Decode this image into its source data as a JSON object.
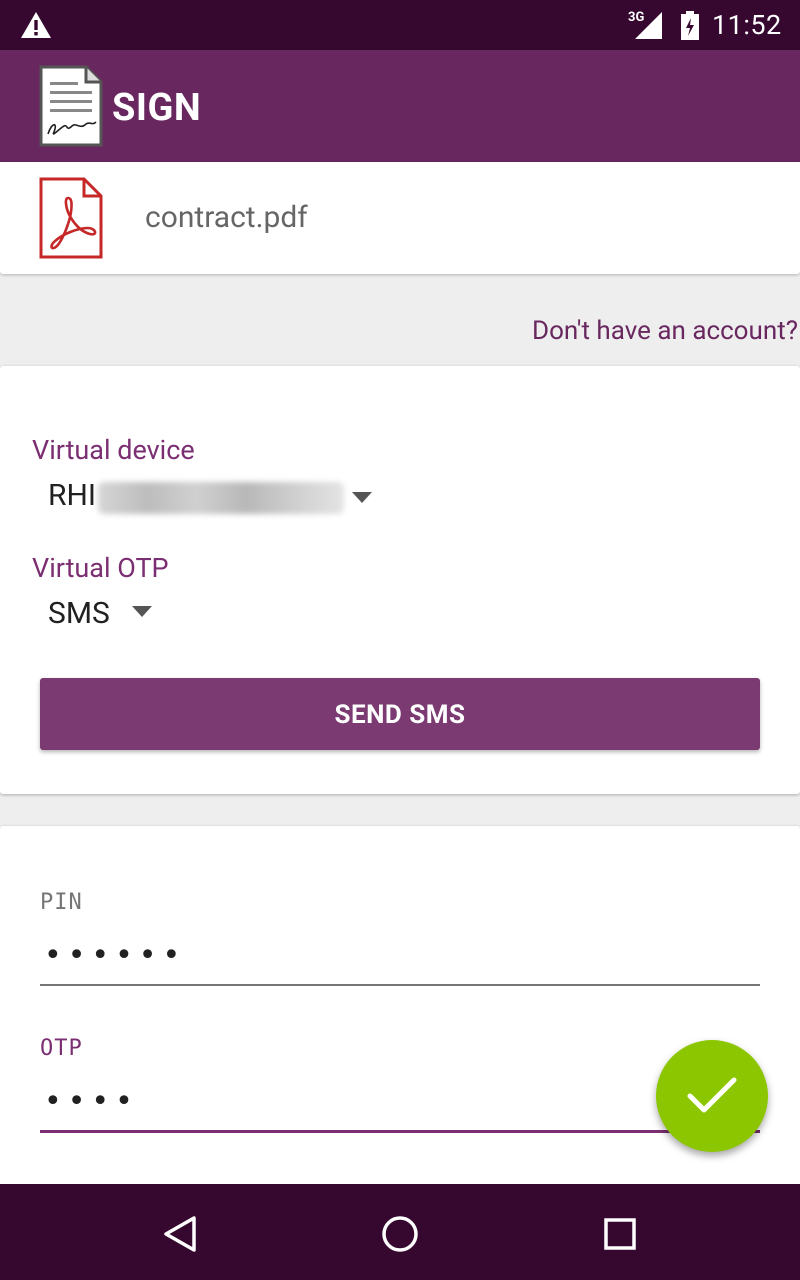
{
  "status_bar": {
    "time": "11:52",
    "network": "3G",
    "icons": [
      "warning-icon",
      "signal-icon",
      "battery-icon"
    ]
  },
  "app_bar": {
    "title": "SIGN",
    "logo_icon": "signed-document-icon"
  },
  "file": {
    "name": "contract.pdf",
    "icon": "pdf-file-icon"
  },
  "account_link": "Don't have an account?",
  "device_section": {
    "virtual_device_label": "Virtual device",
    "virtual_device_value": "RHI",
    "virtual_otp_label": "Virtual OTP",
    "virtual_otp_value": "SMS",
    "send_button": "SEND SMS"
  },
  "credentials": {
    "pin_label": "PIN",
    "pin_value": "••••••",
    "otp_label": "OTP",
    "otp_value": "••••"
  },
  "fab_icon": "checkmark-icon",
  "nav": [
    "back-icon",
    "home-icon",
    "recents-icon"
  ],
  "colors": {
    "primary": "#68285f",
    "primary_dark": "#36082f",
    "accent": "#8cc600",
    "label": "#7b2f72"
  }
}
